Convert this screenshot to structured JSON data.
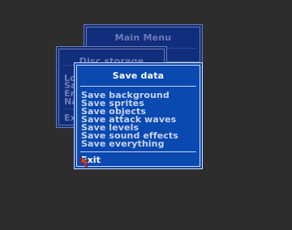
{
  "main_menu": {
    "title": "Main Menu"
  },
  "disc_storage": {
    "title": "Disc storage",
    "items": [
      "Lo",
      "Sa",
      "Er",
      "Na"
    ],
    "exit_label": "Ex"
  },
  "save_data": {
    "title": "Save data",
    "items": [
      "Save background",
      "Save sprites",
      "Save objects",
      "Save attack waves",
      "Save levels",
      "Save sound effects",
      "Save everything"
    ],
    "exit_label": "Exit"
  },
  "colors": {
    "desktop": "#2d2d2d",
    "active_window": "#0a49b0",
    "inactive_window": "#102e7c",
    "active_text": "#c8d4f2",
    "inactive_text": "#6e7cb8",
    "cursor": "#d8402a"
  },
  "cursor": {
    "icon": "arrow-pointer-icon"
  }
}
